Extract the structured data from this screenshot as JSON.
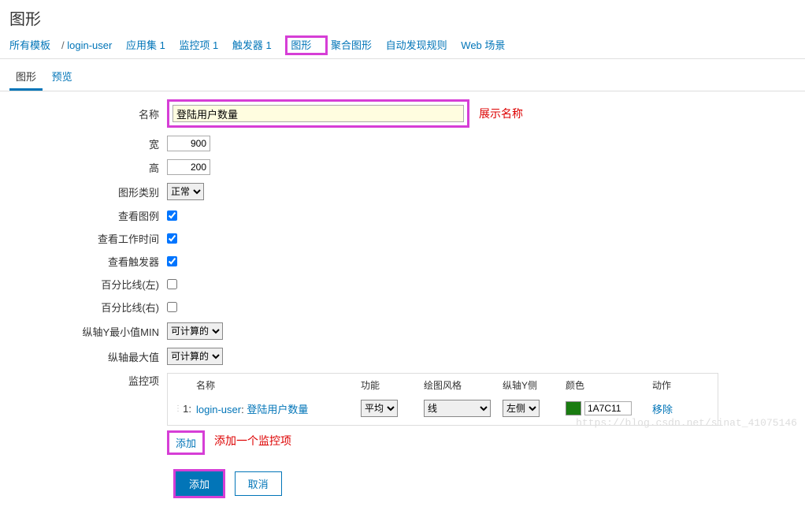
{
  "page_title": "图形",
  "nav": {
    "all_templates": "所有模板",
    "template_name": "login-user",
    "apps": "应用集 1",
    "items": "监控项 1",
    "triggers": "触发器 1",
    "graphs": "图形",
    "aggregated": "聚合图形",
    "discovery": "自动发现规则",
    "web": "Web 场景"
  },
  "subtabs": {
    "graph": "图形",
    "preview": "预览"
  },
  "labels": {
    "name": "名称",
    "width": "宽",
    "height": "高",
    "type": "图形类别",
    "show_legend": "查看图例",
    "show_work": "查看工作时间",
    "show_triggers": "查看触发器",
    "pct_left": "百分比线(左)",
    "pct_right": "百分比线(右)",
    "y_min": "纵轴Y最小值MIN",
    "y_max": "纵轴最大值",
    "items": "监控项"
  },
  "values": {
    "name": "登陆用户数量",
    "width": "900",
    "height": "200",
    "type": "正常",
    "y_min_type": "可计算的",
    "y_max_type": "可计算的"
  },
  "items_table": {
    "h_name": "名称",
    "h_fn": "功能",
    "h_style": "绘图风格",
    "h_side": "纵轴Y侧",
    "h_color": "颜色",
    "h_act": "动作",
    "row1": {
      "idx": "1:",
      "host": "login-user",
      "item": "登陆用户数量",
      "fn": "平均",
      "style": "线",
      "side": "左侧",
      "color": "1A7C11",
      "remove": "移除"
    },
    "add": "添加"
  },
  "buttons": {
    "add": "添加",
    "cancel": "取消"
  },
  "annotations": {
    "show_name": "展示名称",
    "add_item": "添加一个监控项"
  },
  "watermark": "https://blog.csdn.net/sinat_41075146"
}
